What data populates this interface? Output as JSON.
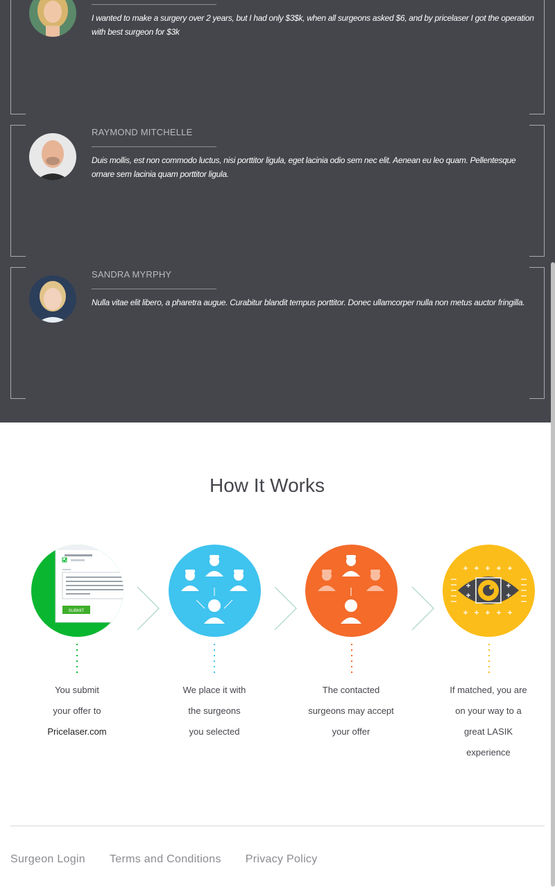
{
  "testimonials": [
    {
      "name": "",
      "text": "I wanted to make a surgery over 2 years, but I had only $3$k, when all surgeons asked $6, and by pricelaser I got the operation with best surgeon for $3k"
    },
    {
      "name": "RAYMOND MITCHELLE",
      "text": "Duis mollis, est non commodo luctus, nisi porttitor ligula, eget lacinia odio sem nec elit. Aenean eu leo quam. Pellentesque ornare sem lacinia quam porttitor ligula."
    },
    {
      "name": "SANDRA MYRPHY",
      "text": "Nulla vitae elit libero, a pharetra augue. Curabitur blandit tempus porttitor. Donec ullamcorper nulla non metus auctor fringilla."
    }
  ],
  "how_it_works": {
    "title": "How It Works",
    "steps": [
      {
        "line1": "You submit",
        "line2": "your offer to",
        "line3": "Pricelaser.com",
        "line4": "",
        "color": "#0ab630",
        "icon": "form-submit-icon",
        "button_label": "SUBMIT"
      },
      {
        "line1": "We place it with",
        "line2": "the surgeons",
        "line3": "you selected",
        "line4": "",
        "color": "#3fc3ef",
        "icon": "surgeons-network-icon"
      },
      {
        "line1": "The contacted",
        "line2": "surgeons may accept",
        "line3": "your offer",
        "line4": "",
        "color": "#f46b2a",
        "icon": "surgeon-accept-icon"
      },
      {
        "line1": "If matched, you are",
        "line2": "on your way to a",
        "line3": "great LASIK",
        "line4": "experience",
        "color": "#fbbd19",
        "icon": "eye-lasik-icon"
      }
    ]
  },
  "footer": {
    "links": [
      "Surgeon Login",
      "Terms and Conditions",
      "Privacy Policy"
    ]
  },
  "colors": {
    "dark_bg": "#45464c",
    "text_dark": "#45464c",
    "footer_link": "#8a8b90"
  }
}
